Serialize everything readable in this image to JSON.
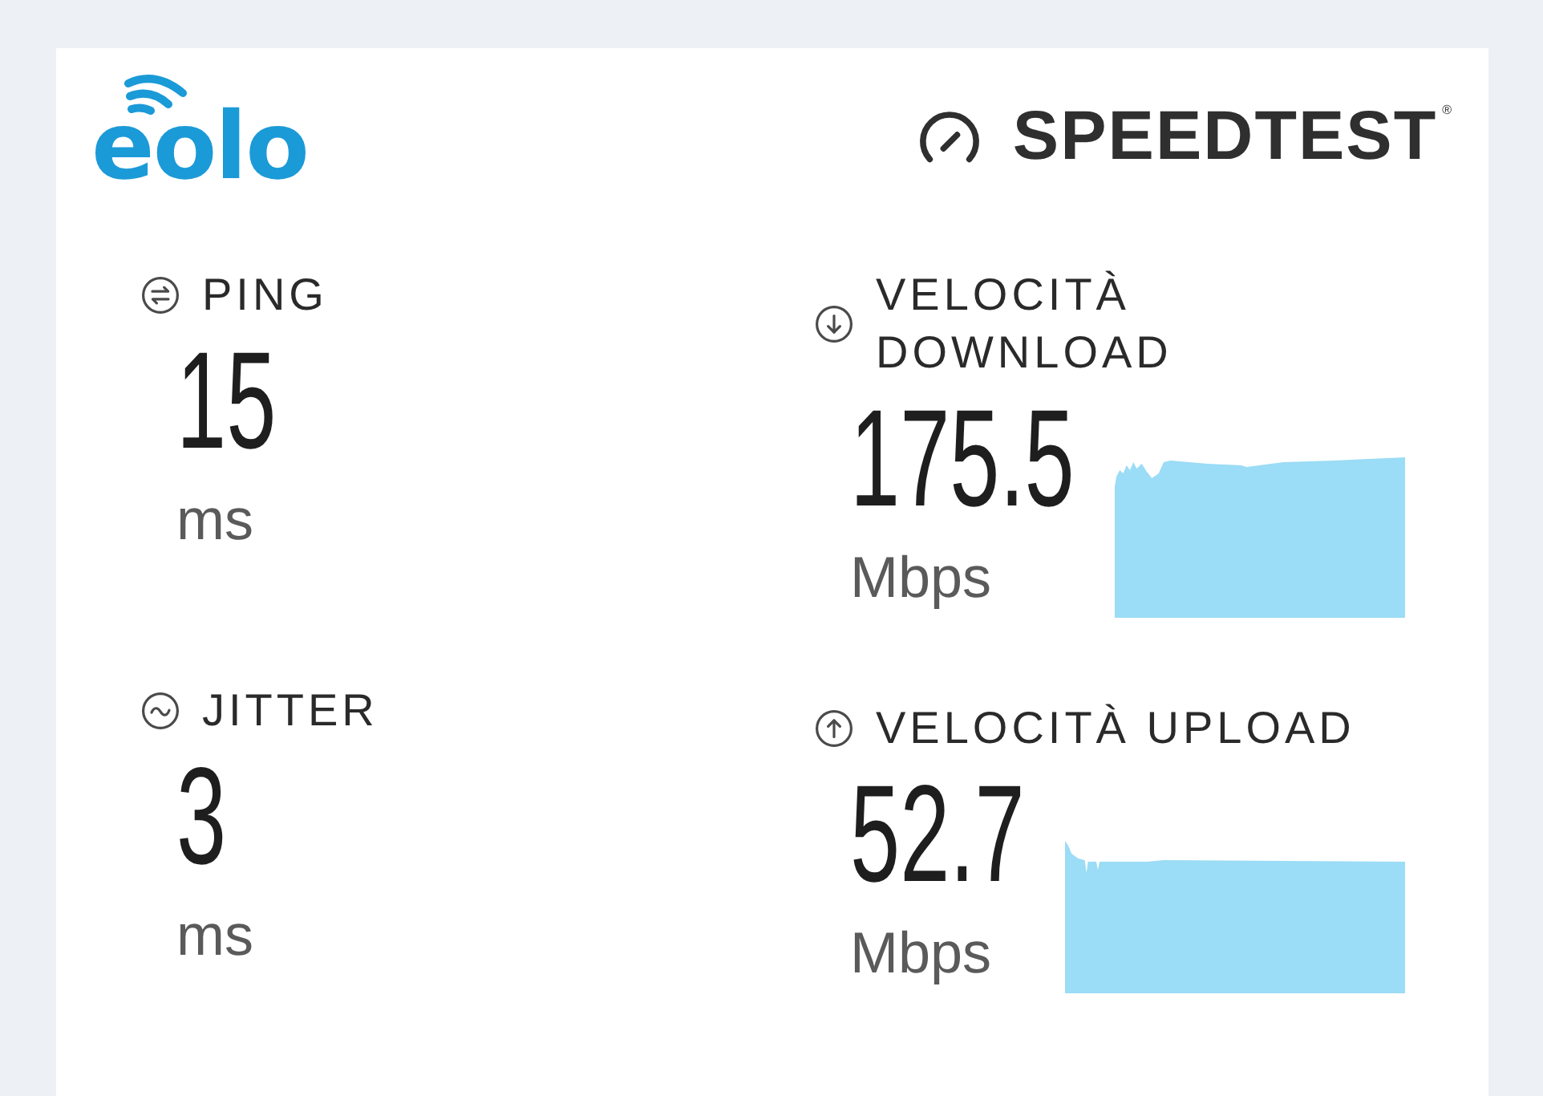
{
  "header": {
    "logo": "eolo",
    "brand": "SPEEDTEST$^{®}$"
  },
  "columns": [
    {
      "metrics": [
        {
          "kind": "ping",
          "label": "PING",
          "value": "15",
          "unit": "ms"
        },
        {
          "kind": "jitter",
          "label": "JITTER",
          "value": "3",
          "unit": "ms"
        }
      ]
    },
    {
      "metrics": [
        {
          "kind": "download",
          "label": "VELOCITÀ DOWNLOAD",
          "value": "175.5",
          "unit": "Mbps"
        },
        {
          "kind": "upload",
          "label": "VELOCITÀ UPLOAD",
          "value": "52.7",
          "unit": "Mbps"
        }
      ]
    }
  ]
}
